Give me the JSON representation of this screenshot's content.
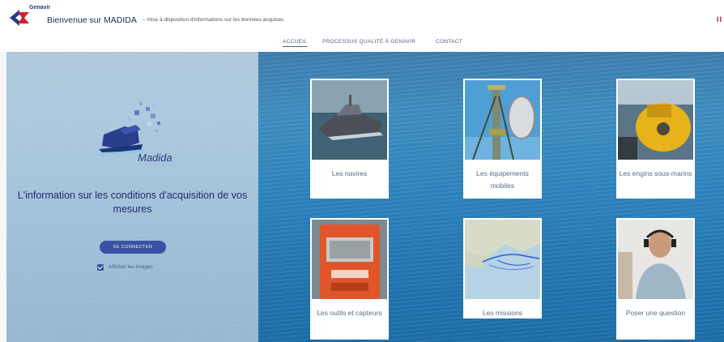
{
  "header": {
    "logo_text": "Genavir",
    "title": "Bienvenue sur MADIDA",
    "subtitle": "– mise à disposition d'informations sur les données acquises",
    "language": "II"
  },
  "nav": {
    "items": [
      {
        "label": "ACCUEIL"
      },
      {
        "label": "PROCESSUS QUALITÉ À GENAVIR"
      },
      {
        "label": "CONTACT"
      }
    ]
  },
  "left": {
    "logo_text": "Madida",
    "tagline": "L'information sur les conditions d'acquisition de vos mesures",
    "connect_label": "SE CONNECTER",
    "show_images_label": "Afficher les images",
    "show_images_checked": true
  },
  "cards": [
    {
      "label": "Les navires",
      "image": "ship-photo"
    },
    {
      "label": "Les équipements mobiles",
      "image": "mast-equipment-photo"
    },
    {
      "label": "Les engins sous-marins",
      "image": "submarine-photo"
    },
    {
      "label": "Les outils et capteurs",
      "image": "sensor-case-photo"
    },
    {
      "label": "Les missions",
      "image": "mission-map-photo"
    },
    {
      "label": "Poser une question",
      "image": "support-agent-photo"
    }
  ],
  "colors": {
    "brand_blue": "#3a52a4",
    "brand_red": "#d2232a",
    "navy": "#1e2f6e"
  }
}
